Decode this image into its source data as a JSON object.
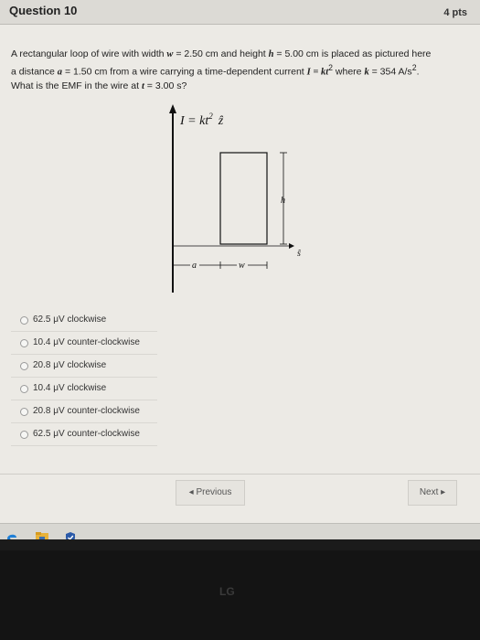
{
  "header": {
    "title": "Question 10",
    "points": "4 pts"
  },
  "prompt": {
    "line1_a": "A rectangular loop of wire with width ",
    "w_sym": "w",
    "line1_b": " = 2.50 cm and height ",
    "h_sym": "h",
    "line1_c": " = 5.00 cm is placed as pictured here",
    "line2_a": "a distance ",
    "a_sym": "a",
    "line2_b": " = 1.50 cm from a wire carrying a time-dependent current ",
    "I_expr": "I = kt",
    "I_exp": "2",
    "line2_c": " where ",
    "k_sym": "k",
    "line2_d": " = 354 A/s",
    "unit_exp": "2",
    "line2_e": ".",
    "line3_a": "What is the EMF in the wire at ",
    "t_sym": "t",
    "line3_b": " = 3.00 s?"
  },
  "figure": {
    "current_label": "I = kt",
    "current_exp": "2",
    "current_dir": "ẑ",
    "h_label": "h",
    "s_label": "ŝ",
    "a_label": "a",
    "w_label": "w"
  },
  "answers": [
    {
      "label": "62.5 μV clockwise"
    },
    {
      "label": "10.4 μV counter-clockwise"
    },
    {
      "label": "20.8 μV clockwise"
    },
    {
      "label": "10.4 μV clockwise"
    },
    {
      "label": "20.8 μV counter-clockwise"
    },
    {
      "label": "62.5 μV counter-clockwise"
    }
  ],
  "nav": {
    "previous": "◂ Previous",
    "next": "Next ▸"
  },
  "taskbar": {
    "icons": [
      "edge-icon",
      "file-explorer-icon",
      "shield-check-icon"
    ]
  },
  "watermark": "LG"
}
